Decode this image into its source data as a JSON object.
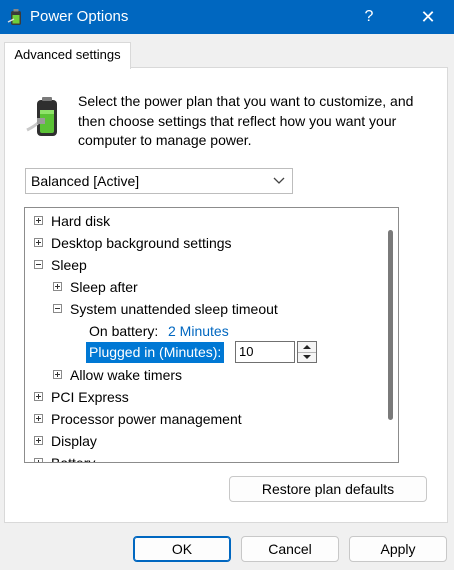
{
  "window": {
    "title": "Power Options",
    "help_label": "?",
    "close_label": "✕"
  },
  "tab": {
    "label": "Advanced settings"
  },
  "description": "Select the power plan that you want to customize, and then choose settings that reflect how you want your computer to manage power.",
  "plan_select": {
    "value": "Balanced [Active]"
  },
  "tree": {
    "hard_disk": "Hard disk",
    "desktop_background": "Desktop background settings",
    "sleep": "Sleep",
    "sleep_after": "Sleep after",
    "system_unattended": "System unattended sleep timeout",
    "on_battery_label": "On battery:",
    "on_battery_value": "2 Minutes",
    "plugged_in_label": "Plugged in (Minutes):",
    "plugged_in_value": "10",
    "allow_wake_timers": "Allow wake timers",
    "pci_express": "PCI Express",
    "processor_power": "Processor power management",
    "display": "Display",
    "battery": "Battery"
  },
  "buttons": {
    "restore": "Restore plan defaults",
    "ok": "OK",
    "cancel": "Cancel",
    "apply": "Apply"
  },
  "colors": {
    "titlebar": "#0067c0",
    "selection": "#0078d4",
    "link": "#0067c0"
  }
}
